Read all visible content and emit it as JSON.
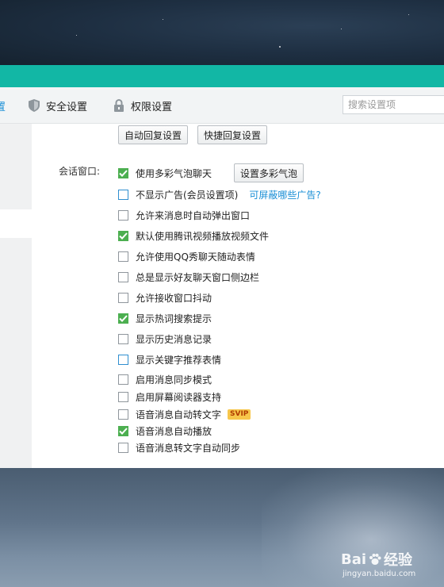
{
  "tabs": {
    "edge_label": "置",
    "security_label": "安全设置",
    "permission_label": "权限设置"
  },
  "search": {
    "placeholder": "搜索设置项"
  },
  "reply_buttons": {
    "auto_reply": "自动回复设置",
    "quick_reply": "快捷回复设置"
  },
  "conversation": {
    "label": "会话窗口:",
    "bubble_button": "设置多彩气泡",
    "ad_link": "可屏蔽哪些广告?",
    "svip_badge": "SVIP",
    "options": [
      {
        "label": "使用多彩气泡聊天",
        "checked": true
      },
      {
        "label": "不显示广告(会员设置项)",
        "checked": false
      },
      {
        "label": "允许来消息时自动弹出窗口",
        "checked": false
      },
      {
        "label": "默认使用腾讯视频播放视频文件",
        "checked": true
      },
      {
        "label": "允许使用QQ秀聊天随动表情",
        "checked": false
      },
      {
        "label": "总是显示好友聊天窗口侧边栏",
        "checked": false
      },
      {
        "label": "允许接收窗口抖动",
        "checked": false
      },
      {
        "label": "显示热词搜索提示",
        "checked": true
      },
      {
        "label": "显示历史消息记录",
        "checked": false
      },
      {
        "label": "显示关键字推荐表情",
        "checked": false
      },
      {
        "label": "启用消息同步模式",
        "checked": false
      },
      {
        "label": "启用屏幕阅读器支持",
        "checked": false
      },
      {
        "label": "语音消息自动转文字",
        "checked": false
      },
      {
        "label": "语音消息自动播放",
        "checked": true
      },
      {
        "label": "语音消息转文字自动同步",
        "checked": false
      }
    ]
  },
  "watermark": {
    "brand": "Bai",
    "brand_suffix": "经验",
    "url": "jingyan.baidu.com"
  },
  "colors": {
    "title_bar": "#12b7a5",
    "checkbox_checked": "#4caf50",
    "link": "#1a8fd6"
  }
}
